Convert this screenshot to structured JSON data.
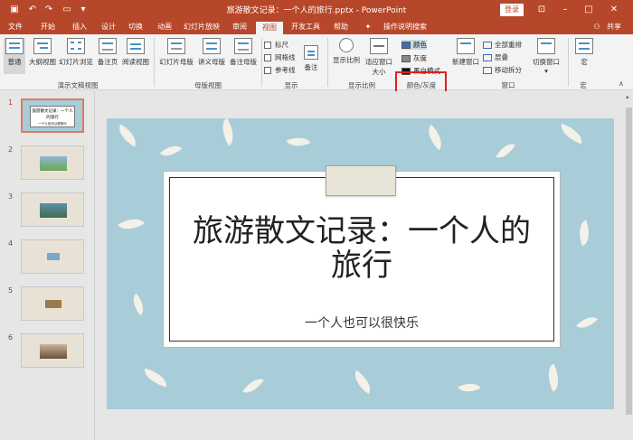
{
  "titlebar": {
    "doc_title": "旅游散文记录：一个人的旅行.pptx - PowerPoint",
    "login_label": "登录",
    "quick_icons": [
      "save-icon",
      "undo-icon",
      "redo-icon",
      "from-beginning-icon",
      "customize-icon"
    ],
    "controls": [
      "ribbon-display-icon",
      "minimize-icon",
      "maximize-icon",
      "close-icon"
    ]
  },
  "tabs": [
    "文件",
    "开始",
    "插入",
    "设计",
    "切换",
    "动画",
    "幻灯片放映",
    "审阅",
    "视图",
    "开发工具",
    "帮助"
  ],
  "tell_me": "操作说明搜索",
  "share": "共享",
  "ribbon": {
    "views": [
      "普通",
      "大纲视图",
      "幻灯片浏览",
      "备注页",
      "阅读视图"
    ],
    "views_group": "演示文稿视图",
    "masters": [
      "幻灯片母版",
      "讲义母版",
      "备注母版"
    ],
    "masters_group": "母版视图",
    "show": [
      "标尺",
      "网格线",
      "参考线"
    ],
    "notes_label": "备注",
    "show_group": "显示",
    "zoom": [
      "显示比例",
      "适应窗口大小"
    ],
    "zoom_group": "显示比例",
    "color": [
      "颜色",
      "灰度",
      "黑白模式"
    ],
    "color_group": "颜色/灰度",
    "window": [
      "新建窗口",
      "全部重排",
      "层叠",
      "移动拆分",
      "切换窗口"
    ],
    "window_group": "窗口",
    "macro": "宏",
    "macro_group": "宏"
  },
  "slides_panel": {
    "numbers": [
      "1",
      "2",
      "3",
      "4",
      "5",
      "6"
    ],
    "thumb1_title": "旅游散文记录：一个人的旅行",
    "thumb1_sub": "一个人也可以很快乐"
  },
  "slide": {
    "title": "旅游散文记录：一个人的旅行",
    "subtitle": "一个人也可以很快乐"
  },
  "colors": {
    "accent": "#b7472a",
    "slide_bg": "#a8cdd8",
    "highlight": "#e02020"
  }
}
